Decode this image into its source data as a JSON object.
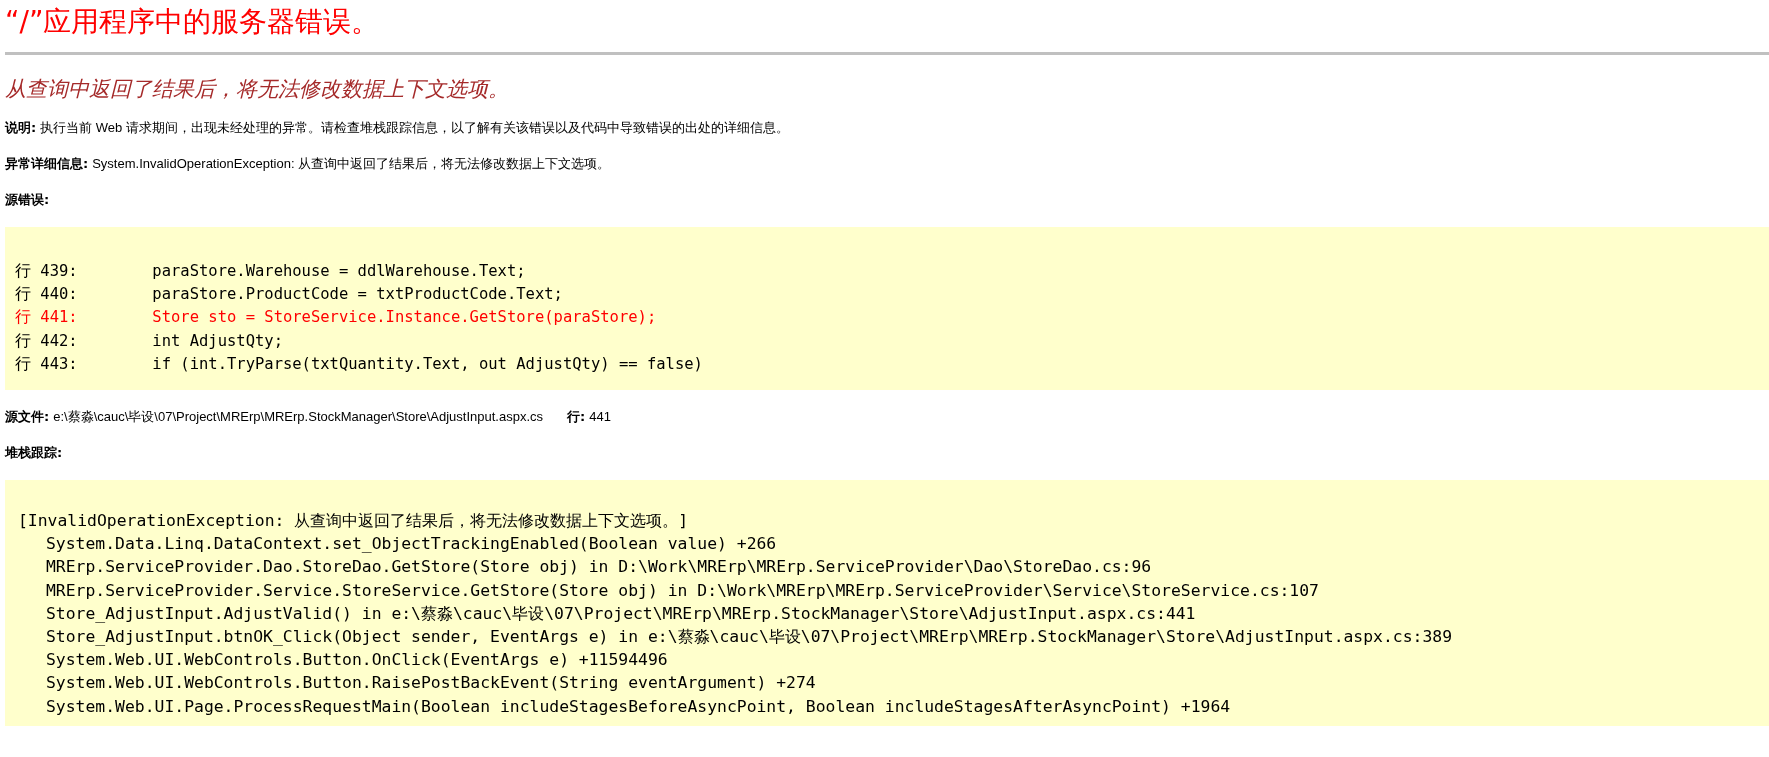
{
  "title": "“/”应用程序中的服务器错误。",
  "message": "从查询中返回了结果后，将无法修改数据上下文选项。",
  "description": {
    "label": "说明:",
    "text": "执行当前 Web 请求期间，出现未经处理的异常。请检查堆栈跟踪信息，以了解有关该错误以及代码中导致错误的出处的详细信息。"
  },
  "exception_details": {
    "label": "异常详细信息:",
    "text": "System.InvalidOperationException: 从查询中返回了结果后，将无法修改数据上下文选项。"
  },
  "source_error": {
    "heading": "源错误:",
    "lines": [
      {
        "text": "行 439:        paraStore.Warehouse = ddlWarehouse.Text;",
        "highlighted": false
      },
      {
        "text": "行 440:        paraStore.ProductCode = txtProductCode.Text;",
        "highlighted": false
      },
      {
        "text": "行 441:        Store sto = StoreService.Instance.GetStore(paraStore);",
        "highlighted": true
      },
      {
        "text": "行 442:        int AdjustQty;",
        "highlighted": false
      },
      {
        "text": "行 443:        if (int.TryParse(txtQuantity.Text, out AdjustQty) == false)",
        "highlighted": false
      }
    ]
  },
  "source_file": {
    "label": "源文件:",
    "path": "e:\\蔡淼\\cauc\\毕设\\07\\Project\\MRErp\\MRErp.StockManager\\Store\\AdjustInput.aspx.cs",
    "line_label": "行:",
    "line": "441"
  },
  "stack_trace": {
    "heading": "堆栈跟踪:",
    "exception": "[InvalidOperationException: 从查询中返回了结果后，将无法修改数据上下文选项。]",
    "frames": [
      "System.Data.Linq.DataContext.set_ObjectTrackingEnabled(Boolean value) +266",
      "MRErp.ServiceProvider.Dao.StoreDao.GetStore(Store obj) in D:\\Work\\MRErp\\MRErp.ServiceProvider\\Dao\\StoreDao.cs:96",
      "MRErp.ServiceProvider.Service.StoreService.GetStore(Store obj) in D:\\Work\\MRErp\\MRErp.ServiceProvider\\Service\\StoreService.cs:107",
      "Store_AdjustInput.AdjustValid() in e:\\蔡淼\\cauc\\毕设\\07\\Project\\MRErp\\MRErp.StockManager\\Store\\AdjustInput.aspx.cs:441",
      "Store_AdjustInput.btnOK_Click(Object sender, EventArgs e) in e:\\蔡淼\\cauc\\毕设\\07\\Project\\MRErp\\MRErp.StockManager\\Store\\AdjustInput.aspx.cs:389",
      "System.Web.UI.WebControls.Button.OnClick(EventArgs e) +11594496",
      "System.Web.UI.WebControls.Button.RaisePostBackEvent(String eventArgument) +274",
      "System.Web.UI.Page.ProcessRequestMain(Boolean includeStagesBeforeAsyncPoint, Boolean includeStagesAfterAsyncPoint) +1964"
    ]
  }
}
